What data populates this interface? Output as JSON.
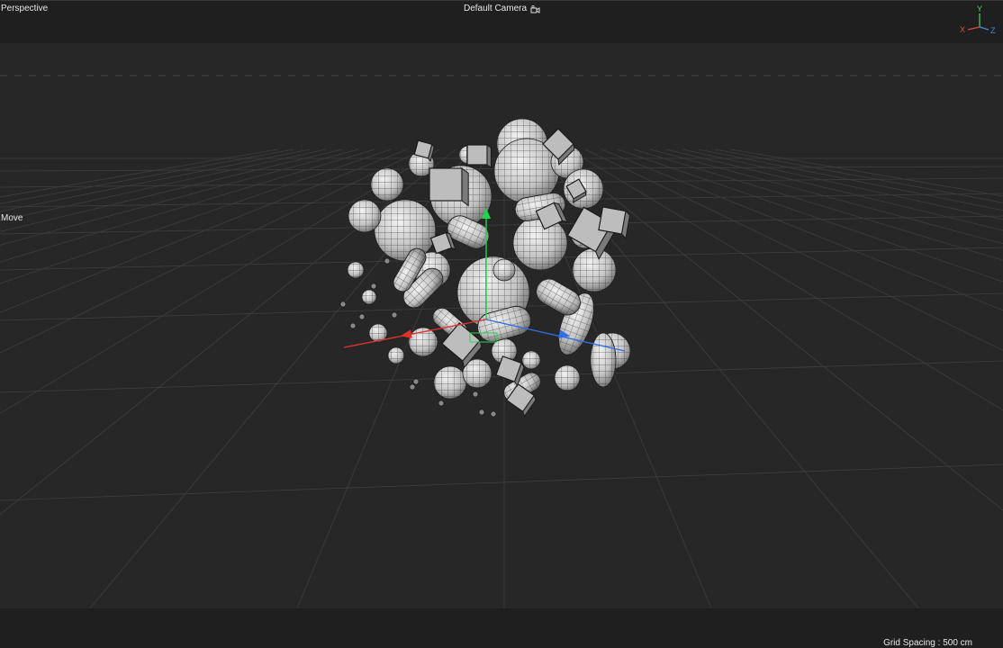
{
  "viewport": {
    "view_name": "Perspective",
    "camera_name": "Default Camera",
    "active_tool": "Move",
    "grid_spacing": "Grid Spacing : 500 cm"
  },
  "axis_widget": {
    "x_label": "X",
    "y_label": "Y",
    "z_label": "Z",
    "x_color": "#e04a3a",
    "y_color": "#4ad66a",
    "z_color": "#3a8ee6"
  },
  "icons": {
    "camera": "camera-icon",
    "axis": "axis-gizmo-icon"
  },
  "colors": {
    "background": "#272727",
    "grid": "#3e3e3e",
    "object_fill": "#c9c9c9",
    "object_wire": "#1a1a1a",
    "gizmo_x": "#e0322b",
    "gizmo_y": "#1ed64a",
    "gizmo_z": "#2f6fe6"
  }
}
